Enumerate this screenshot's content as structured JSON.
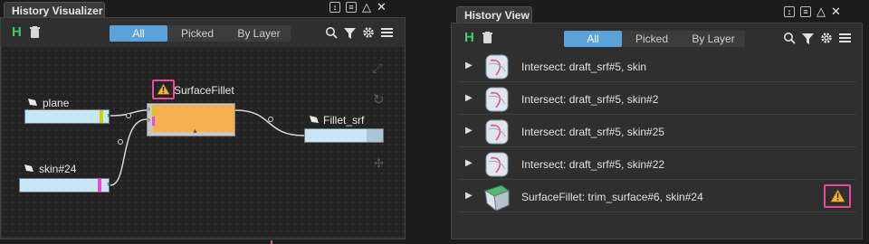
{
  "left_panel": {
    "title": "History Visualizer",
    "tabs": [
      "All",
      "Picked",
      "By Layer"
    ],
    "active_tab": "All",
    "nodes": {
      "plane": "plane",
      "skin": "skin#24",
      "surface_fillet": "SurfaceFillet",
      "fillet_srf": "Fillet_srf"
    }
  },
  "right_panel": {
    "title": "History View",
    "tabs": [
      "All",
      "Picked",
      "By Layer"
    ],
    "active_tab": "All",
    "rows": [
      {
        "label": "Intersect: draft_srf#5, skin"
      },
      {
        "label": "Intersect: draft_srf#5, skin#2"
      },
      {
        "label": "Intersect: draft_srf#5, skin#25"
      },
      {
        "label": "Intersect: draft_srf#5, skin#22"
      },
      {
        "label": "SurfaceFillet: trim_surface#6, skin#24",
        "warning": true
      }
    ]
  },
  "colors": {
    "accent_blue": "#5aa2d8",
    "node_orange": "#f5b052",
    "highlight_pink": "#e84aa0",
    "history_green": "#3fcf6a"
  }
}
